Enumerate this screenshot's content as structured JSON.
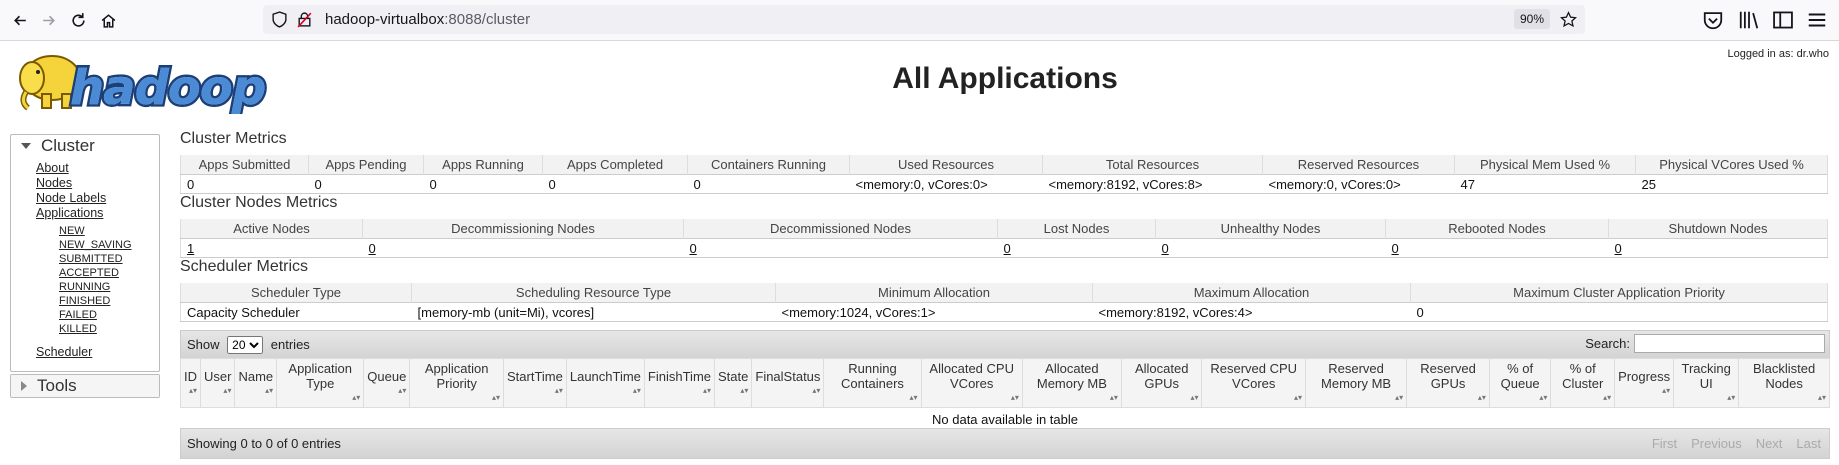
{
  "browser": {
    "url_host": "hadoop-virtualbox",
    "url_path": ":8088/cluster",
    "zoom": "90%"
  },
  "header": {
    "title": "All Applications",
    "login": "Logged in as: dr.who",
    "logo_text": "hadoop"
  },
  "sidebar": {
    "cluster_title": "Cluster",
    "links": [
      "About",
      "Nodes",
      "Node Labels",
      "Applications"
    ],
    "app_states": [
      "NEW",
      "NEW_SAVING",
      "SUBMITTED",
      "ACCEPTED",
      "RUNNING",
      "FINISHED",
      "FAILED",
      "KILLED"
    ],
    "scheduler": "Scheduler",
    "tools_title": "Tools"
  },
  "cluster_metrics": {
    "title": "Cluster Metrics",
    "headers": [
      "Apps Submitted",
      "Apps Pending",
      "Apps Running",
      "Apps Completed",
      "Containers Running",
      "Used Resources",
      "Total Resources",
      "Reserved Resources",
      "Physical Mem Used %",
      "Physical VCores Used %"
    ],
    "values": [
      "0",
      "0",
      "0",
      "0",
      "0",
      "<memory:0, vCores:0>",
      "<memory:8192, vCores:8>",
      "<memory:0, vCores:0>",
      "47",
      "25"
    ]
  },
  "nodes_metrics": {
    "title": "Cluster Nodes Metrics",
    "headers": [
      "Active Nodes",
      "Decommissioning Nodes",
      "Decommissioned Nodes",
      "Lost Nodes",
      "Unhealthy Nodes",
      "Rebooted Nodes",
      "Shutdown Nodes"
    ],
    "values": [
      "1",
      "0",
      "0",
      "0",
      "0",
      "0",
      "0"
    ]
  },
  "scheduler_metrics": {
    "title": "Scheduler Metrics",
    "headers": [
      "Scheduler Type",
      "Scheduling Resource Type",
      "Minimum Allocation",
      "Maximum Allocation",
      "Maximum Cluster Application Priority"
    ],
    "values": [
      "Capacity Scheduler",
      "[memory-mb (unit=Mi), vcores]",
      "<memory:1024, vCores:1>",
      "<memory:8192, vCores:4>",
      "0"
    ]
  },
  "table_controls": {
    "show_label": "Show",
    "entries_value": "20",
    "entries_label": "entries",
    "search_label": "Search:"
  },
  "apps_table": {
    "columns": [
      "ID",
      "User",
      "Name",
      "Application Type",
      "Queue",
      "Application Priority",
      "StartTime",
      "LaunchTime",
      "FinishTime",
      "State",
      "FinalStatus",
      "Running Containers",
      "Allocated CPU VCores",
      "Allocated Memory MB",
      "Allocated GPUs",
      "Reserved CPU VCores",
      "Reserved Memory MB",
      "Reserved GPUs",
      "% of Queue",
      "% of Cluster",
      "Progress",
      "Tracking UI",
      "Blacklisted Nodes"
    ],
    "empty_message": "No data available in table",
    "info": "Showing 0 to 0 of 0 entries",
    "pager": [
      "First",
      "Previous",
      "Next",
      "Last"
    ]
  }
}
